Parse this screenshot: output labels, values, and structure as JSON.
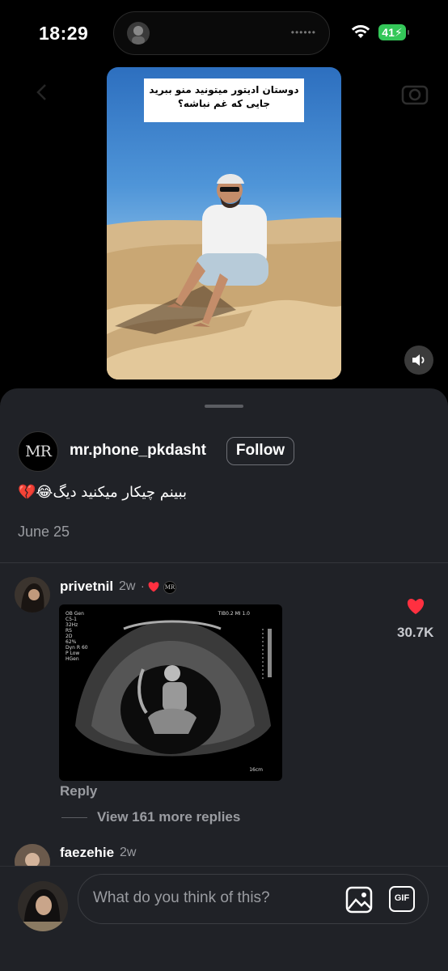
{
  "status_bar": {
    "time": "18:29",
    "battery": "41"
  },
  "video": {
    "caption_line1": "دوستان ادیتور میتونید منو ببرید",
    "caption_line2": "جایی که غم نباشه؟"
  },
  "post": {
    "username": "mr.phone_pkdasht",
    "follow_label": "Follow",
    "text": "ببینم چیکار میکنید دیگ😂💔",
    "date": "June 25",
    "avatar_text": "MR"
  },
  "comments": [
    {
      "username": "privetnil",
      "time": "2w",
      "separator": "·",
      "like_count": "30.7K",
      "reply_label": "Reply",
      "view_more": "View 161 more replies",
      "image": {
        "left_lines": [
          "OB Gen",
          "C5-1",
          "32Hz",
          "RS",
          "",
          "2D",
          "62%",
          "Dyn R 60",
          "P Low",
          "HGen"
        ],
        "right_text": "TIB0.2   MI 1.0",
        "depth_text": "16cm"
      }
    },
    {
      "username": "faezehie",
      "time": "2w"
    }
  ],
  "composer": {
    "placeholder": "What do you think of this?",
    "gif_label": "GIF"
  },
  "colors": {
    "sheet": "#202227",
    "heart": "#ff3040",
    "battery": "#34c759"
  }
}
